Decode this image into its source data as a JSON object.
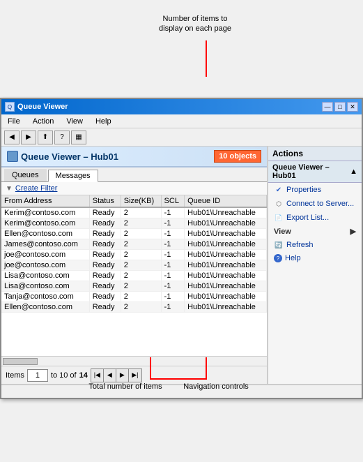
{
  "annotations": {
    "top_label": "Number of items to\ndisplay on each page",
    "bottom_total_label": "Total number of items",
    "bottom_nav_label": "Navigation controls"
  },
  "window": {
    "title": "Queue Viewer",
    "min_btn": "—",
    "max_btn": "□",
    "close_btn": "✕"
  },
  "menu": {
    "items": [
      "File",
      "Action",
      "View",
      "Help"
    ]
  },
  "qv_header": {
    "title": "Queue Viewer – Hub01",
    "badge": "10 objects"
  },
  "tabs": [
    {
      "label": "Queues",
      "active": false
    },
    {
      "label": "Messages",
      "active": true
    }
  ],
  "filter": {
    "label": "Create Filter"
  },
  "table": {
    "columns": [
      "From Address",
      "Status",
      "Size(KB)",
      "SCL",
      "Queue ID"
    ],
    "rows": [
      [
        "Kerim@contoso.com",
        "Ready",
        "2",
        "-1",
        "Hub01\\Unreachable"
      ],
      [
        "Kerim@contoso.com",
        "Ready",
        "2",
        "-1",
        "Hub01\\Unreachable"
      ],
      [
        "Ellen@contoso.com",
        "Ready",
        "2",
        "-1",
        "Hub01\\Unreachable"
      ],
      [
        "James@contoso.com",
        "Ready",
        "2",
        "-1",
        "Hub01\\Unreachable"
      ],
      [
        "joe@contoso.com",
        "Ready",
        "2",
        "-1",
        "Hub01\\Unreachable"
      ],
      [
        "joe@contoso.com",
        "Ready",
        "2",
        "-1",
        "Hub01\\Unreachable"
      ],
      [
        "Lisa@contoso.com",
        "Ready",
        "2",
        "-1",
        "Hub01\\Unreachable"
      ],
      [
        "Lisa@contoso.com",
        "Ready",
        "2",
        "-1",
        "Hub01\\Unreachable"
      ],
      [
        "Tanja@contoso.com",
        "Ready",
        "2",
        "-1",
        "Hub01\\Unreachable"
      ],
      [
        "Ellen@contoso.com",
        "Ready",
        "2",
        "-1",
        "Hub01\\Unreachable"
      ]
    ]
  },
  "pagination": {
    "items_label": "Items",
    "current_start": "1",
    "to_label": "to 10 of",
    "total": "14"
  },
  "actions": {
    "header": "Actions",
    "section_title": "Queue Viewer – Hub01",
    "items": [
      {
        "label": "Properties",
        "icon": "✔"
      },
      {
        "label": "Connect to Server...",
        "icon": "🖥"
      },
      {
        "label": "Export List...",
        "icon": "📋"
      },
      {
        "label": "View",
        "icon": "",
        "has_arrow": true
      },
      {
        "label": "Refresh",
        "icon": "🔄"
      },
      {
        "label": "Help",
        "icon": "?"
      }
    ]
  },
  "status_bar": {
    "text": ""
  }
}
